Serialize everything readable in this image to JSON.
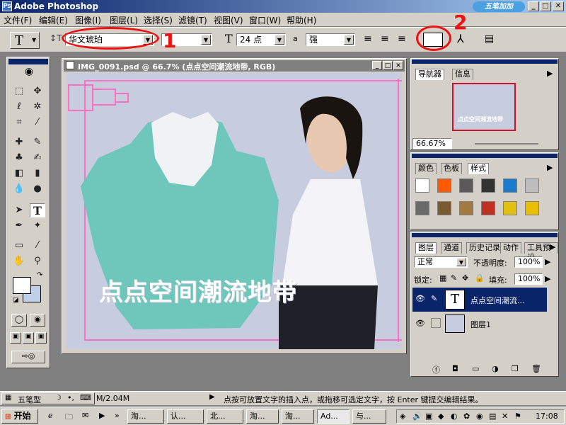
{
  "app": {
    "title": "Adobe Photoshop"
  },
  "menu": [
    "文件(F)",
    "编辑(E)",
    "图像(I)",
    "图层(L)",
    "选择(S)",
    "滤镜(T)",
    "视图(V)",
    "窗口(W)",
    "帮助(H)"
  ],
  "watermark": "五笔加加",
  "options": {
    "tool_glyph": "T",
    "font_family": "华文琥珀",
    "font_size": "24 点",
    "aa_label": "a",
    "aa_value": "强",
    "annotation_1": "1",
    "annotation_2": "2"
  },
  "document": {
    "title": "IMG_0091.psd @ 66.7% (点点空间潮流地带, RGB)",
    "overlay_text": "点点空间潮流地带"
  },
  "navigator": {
    "tabs": [
      "导航器",
      "信息"
    ],
    "zoom": "66.67%",
    "thumb_text": "点点空间潮流地带"
  },
  "swatches": {
    "tabs": [
      "颜色",
      "色板",
      "样式"
    ],
    "colors": [
      "#ffffff",
      "#ff5a00",
      "#5a5a5a",
      "#333333",
      "#1a7acb",
      "#bdbdbd",
      "#6a6a6a",
      "#7a5a30",
      "#a07a40",
      "#c03020",
      "#e0c010",
      "#e8c000"
    ]
  },
  "layers": {
    "tabs": [
      "图层",
      "通道",
      "历史记录",
      "动作",
      "工具预设"
    ],
    "blend_mode": "正常",
    "opacity_label": "不透明度:",
    "opacity": "100%",
    "lock_label": "锁定:",
    "fill_label": "填充:",
    "fill": "100%",
    "items": [
      {
        "name": "点点空间潮流...",
        "type": "text",
        "selected": true
      },
      {
        "name": "图层1",
        "type": "image",
        "selected": false
      }
    ]
  },
  "status": {
    "ime": "五笔型",
    "doc_size": "M/2.04M",
    "message": "点按可放置文字的插入点，或拖移可选定文字，按 Enter 键提交编辑结果。"
  },
  "taskbar": {
    "start": "开始",
    "tasks": [
      "淘...",
      "认...",
      "北...",
      "淘...",
      "淘...",
      "Ad...",
      "与..."
    ],
    "time": "17:08"
  }
}
